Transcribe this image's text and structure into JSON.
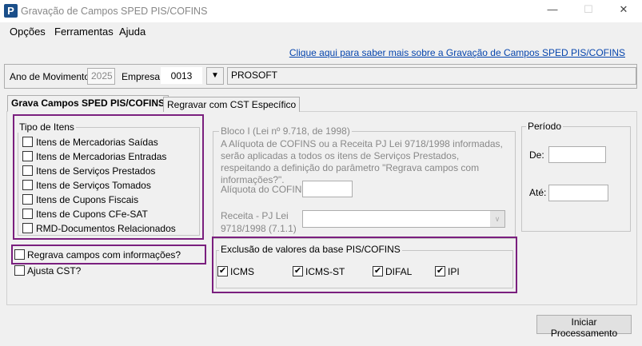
{
  "window": {
    "title": "Gravação de Campos SPED PIS/COFINS",
    "logo": "P"
  },
  "menu": [
    "Opções",
    "Ferramentas",
    "Ajuda"
  ],
  "link": "Clique aqui para saber mais sobre a Gravação de Campos SPED PIS/COFINS",
  "header": {
    "ano_label": "Ano de Movimento:",
    "ano_value": "2025",
    "empresa_label": "Empresa:",
    "empresa_code": "0013",
    "empresa_name": "PROSOFT"
  },
  "tabs": [
    "Grava Campos SPED PIS/COFINS",
    "Regravar com CST Específico"
  ],
  "tipo": {
    "title": "Tipo de Itens",
    "items": [
      "Itens de Mercadorias Saídas",
      "Itens de Mercadorias Entradas",
      "Itens de Serviços Prestados",
      "Itens de Serviços Tomados",
      "Itens de Cupons Fiscais",
      "Itens de Cupons CFe-SAT",
      "RMD-Documentos Relacionados"
    ]
  },
  "regrava": "Regrava campos com informações?",
  "ajusta": "Ajusta CST?",
  "bloco": {
    "title": "Bloco I (Lei nº 9.718, de 1998)",
    "text": "A Alíquota de COFINS ou a Receita PJ Lei 9718/1998 informadas, serão aplicadas a todos os itens de Serviços Prestados, respeitando a definição do parâmetro \"Regrava campos com informações?\".",
    "aliquota_label": "Alíquota do COFINS",
    "receita_label_1": "Receita - PJ Lei",
    "receita_label_2": "9718/1998 (7.1.1)"
  },
  "exclusao": {
    "title": "Exclusão de valores da base PIS/COFINS",
    "items": [
      {
        "label": "ICMS",
        "checked": true
      },
      {
        "label": "ICMS-ST",
        "checked": true
      },
      {
        "label": "DIFAL",
        "checked": true
      },
      {
        "label": "IPI",
        "checked": true
      }
    ]
  },
  "periodo": {
    "title": "Período",
    "de": "De:",
    "ate": "Até:"
  },
  "start_button": "Iniciar Processamento",
  "check": "✔"
}
